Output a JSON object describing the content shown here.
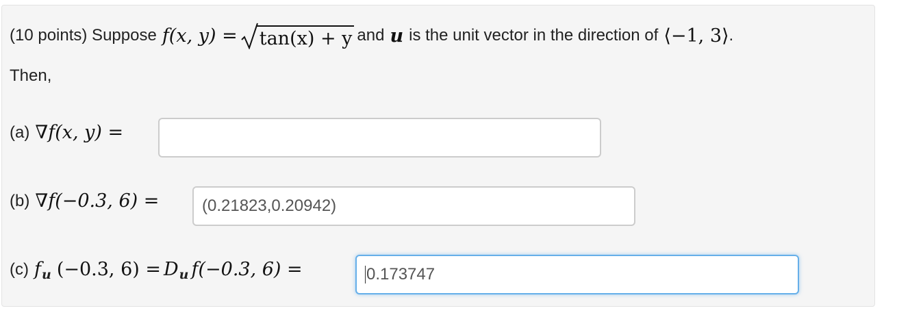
{
  "problem": {
    "intro": "(10 points) Suppose",
    "f_lhs": "f(x, y) =",
    "radicand": "tan(x) + y",
    "connector": "and",
    "u_symbol": "u",
    "u_desc": "is the unit vector in the direction of",
    "direction": "⟨−1, 3⟩",
    "period": ".",
    "then": "Then,"
  },
  "parts": [
    {
      "label": "(a)",
      "expression": "∇f(x, y) =",
      "answer": ""
    },
    {
      "label": "(b)",
      "expression": "∇f(−0.3, 6) =",
      "answer": "(0.21823,0.20942)"
    },
    {
      "label": "(c)",
      "expr_f": "f",
      "expr_u_sub": "u",
      "expr_mid": "(−0.3, 6) =",
      "expr_D": "D",
      "expr_u_sub2": "u",
      "expr_end": "f(−0.3, 6) =",
      "answer": "0.173747"
    }
  ]
}
